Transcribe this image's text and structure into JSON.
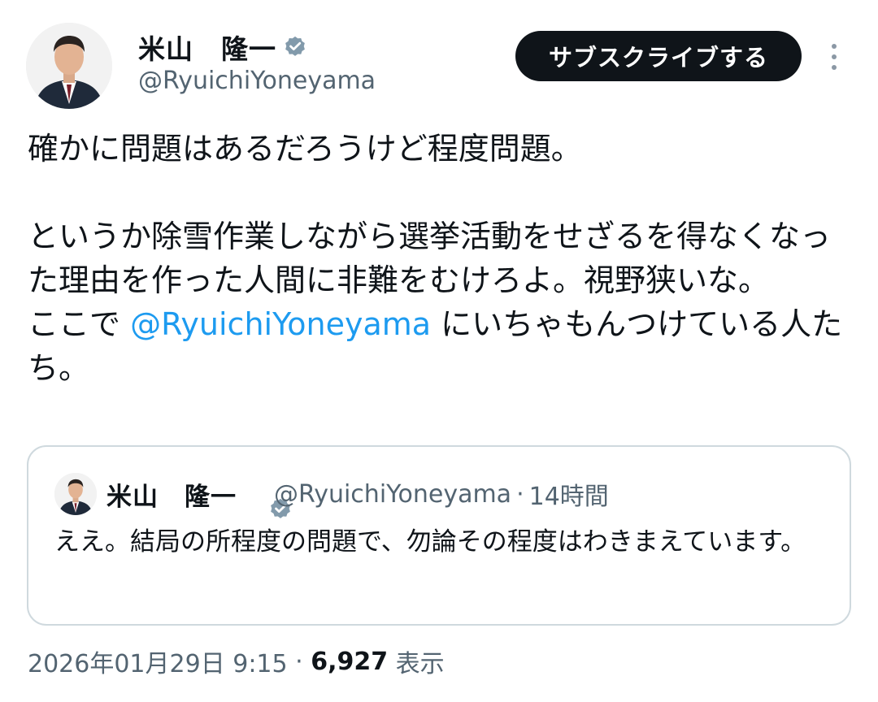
{
  "author": {
    "display_name": "米山　隆一",
    "handle": "@RyuichiYoneyama",
    "verified_icon": "verified-badge-icon"
  },
  "header": {
    "subscribe_label": "サブスクライブする",
    "more_icon": "more-vertical-icon"
  },
  "tweet": {
    "line1": "確かに問題はあるだろうけど程度問題。",
    "line2": "というか除雪作業しながら選挙活動をせざるを得なくなった理由を作った人間に非難をむけろよ。視野狭いな。",
    "line3_prefix": "ここで ",
    "line3_mention": "@RyuichiYoneyama",
    "line3_suffix": " にいちゃもんつけている人たち。"
  },
  "quote": {
    "display_name": "米山　隆一",
    "handle": "@RyuichiYoneyama",
    "separator": "·",
    "time": "14時間",
    "text": "ええ。結局の所程度の問題で、勿論その程度はわきまえています。"
  },
  "meta": {
    "datetime": "2026年01月29日 9:15",
    "separator": " · ",
    "views_count": "6,927",
    "views_label": " 表示"
  },
  "colors": {
    "text": "#0f1419",
    "secondary": "#536471",
    "mention": "#1d9bf0",
    "button_bg": "#0f1419",
    "border": "#cfd9de"
  }
}
